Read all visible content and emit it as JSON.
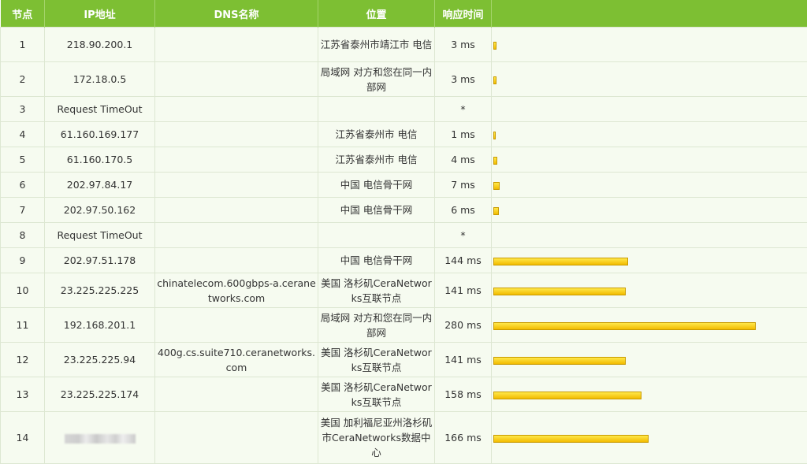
{
  "header": {
    "node": "节点",
    "ip": "IP地址",
    "dns": "DNS名称",
    "location": "位置",
    "time": "响应时间"
  },
  "colors": {
    "header_bg": "#7dbf33",
    "bar_fill": "#f5c800"
  },
  "rows": [
    {
      "node": "1",
      "ip": "218.90.200.1",
      "dns": "",
      "location": "江苏省泰州市靖江市 电信",
      "time": "3 ms",
      "ms": 3
    },
    {
      "node": "2",
      "ip": "172.18.0.5",
      "dns": "",
      "location": "局域网 对方和您在同一内部网",
      "time": "3 ms",
      "ms": 3
    },
    {
      "node": "3",
      "ip": "Request TimeOut",
      "dns": "",
      "location": "",
      "time": "*",
      "ms": 0
    },
    {
      "node": "4",
      "ip": "61.160.169.177",
      "dns": "",
      "location": "江苏省泰州市 电信",
      "time": "1 ms",
      "ms": 1
    },
    {
      "node": "5",
      "ip": "61.160.170.5",
      "dns": "",
      "location": "江苏省泰州市 电信",
      "time": "4 ms",
      "ms": 4
    },
    {
      "node": "6",
      "ip": "202.97.84.17",
      "dns": "",
      "location": "中国 电信骨干网",
      "time": "7 ms",
      "ms": 7
    },
    {
      "node": "7",
      "ip": "202.97.50.162",
      "dns": "",
      "location": "中国 电信骨干网",
      "time": "6 ms",
      "ms": 6
    },
    {
      "node": "8",
      "ip": "Request TimeOut",
      "dns": "",
      "location": "",
      "time": "*",
      "ms": 0
    },
    {
      "node": "9",
      "ip": "202.97.51.178",
      "dns": "",
      "location": "中国 电信骨干网",
      "time": "144 ms",
      "ms": 144
    },
    {
      "node": "10",
      "ip": "23.225.225.225",
      "dns": "chinatelecom.600gbps-a.ceranetworks.com",
      "location": "美国 洛杉矶CeraNetworks互联节点",
      "time": "141 ms",
      "ms": 141
    },
    {
      "node": "11",
      "ip": "192.168.201.1",
      "dns": "",
      "location": "局域网 对方和您在同一内部网",
      "time": "280 ms",
      "ms": 280
    },
    {
      "node": "12",
      "ip": "23.225.225.94",
      "dns": "400g.cs.suite710.ceranetworks.com",
      "location": "美国 洛杉矶CeraNetworks互联节点",
      "time": "141 ms",
      "ms": 141
    },
    {
      "node": "13",
      "ip": "23.225.225.174",
      "dns": "",
      "location": "美国 洛杉矶CeraNetworks互联节点",
      "time": "158 ms",
      "ms": 158
    },
    {
      "node": "14",
      "ip": "",
      "ip_redacted": true,
      "dns": "",
      "location": "美国 加利福尼亚州洛杉矶市CeraNetworks数据中心",
      "time": "166 ms",
      "ms": 166
    }
  ]
}
